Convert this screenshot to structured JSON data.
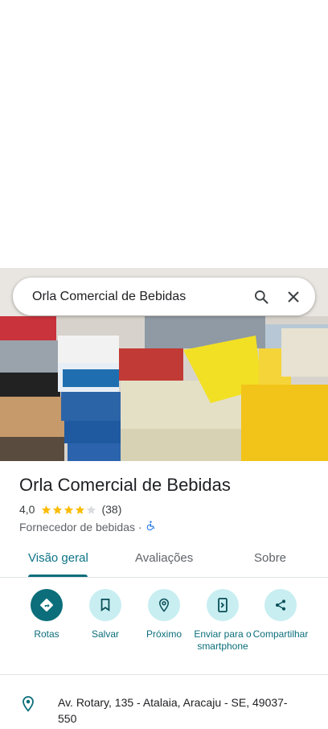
{
  "search": {
    "query": "Orla Comercial de Bebidas"
  },
  "place": {
    "title": "Orla Comercial de Bebidas",
    "rating_text": "4,0",
    "rating_value": 4.0,
    "reviews_count": "(38)",
    "category": "Fornecedor de bebidas",
    "separator": "·"
  },
  "tabs": [
    {
      "label": "Visão geral",
      "active": true
    },
    {
      "label": "Avaliações",
      "active": false
    },
    {
      "label": "Sobre",
      "active": false
    }
  ],
  "actions": [
    {
      "label": "Rotas",
      "icon": "directions-icon"
    },
    {
      "label": "Salvar",
      "icon": "bookmark-icon"
    },
    {
      "label": "Próximo",
      "icon": "nearby-icon"
    },
    {
      "label": "Enviar para o smartphone",
      "icon": "send-to-phone-icon"
    },
    {
      "label": "Compartilhar",
      "icon": "share-icon"
    }
  ],
  "address": {
    "text": "Av. Rotary, 135 - Atalaia, Aracaju - SE, 49037-550"
  },
  "colors": {
    "accent": "#0b6e7a",
    "accent_light": "#c8eef1",
    "star": "#fbbc04"
  }
}
